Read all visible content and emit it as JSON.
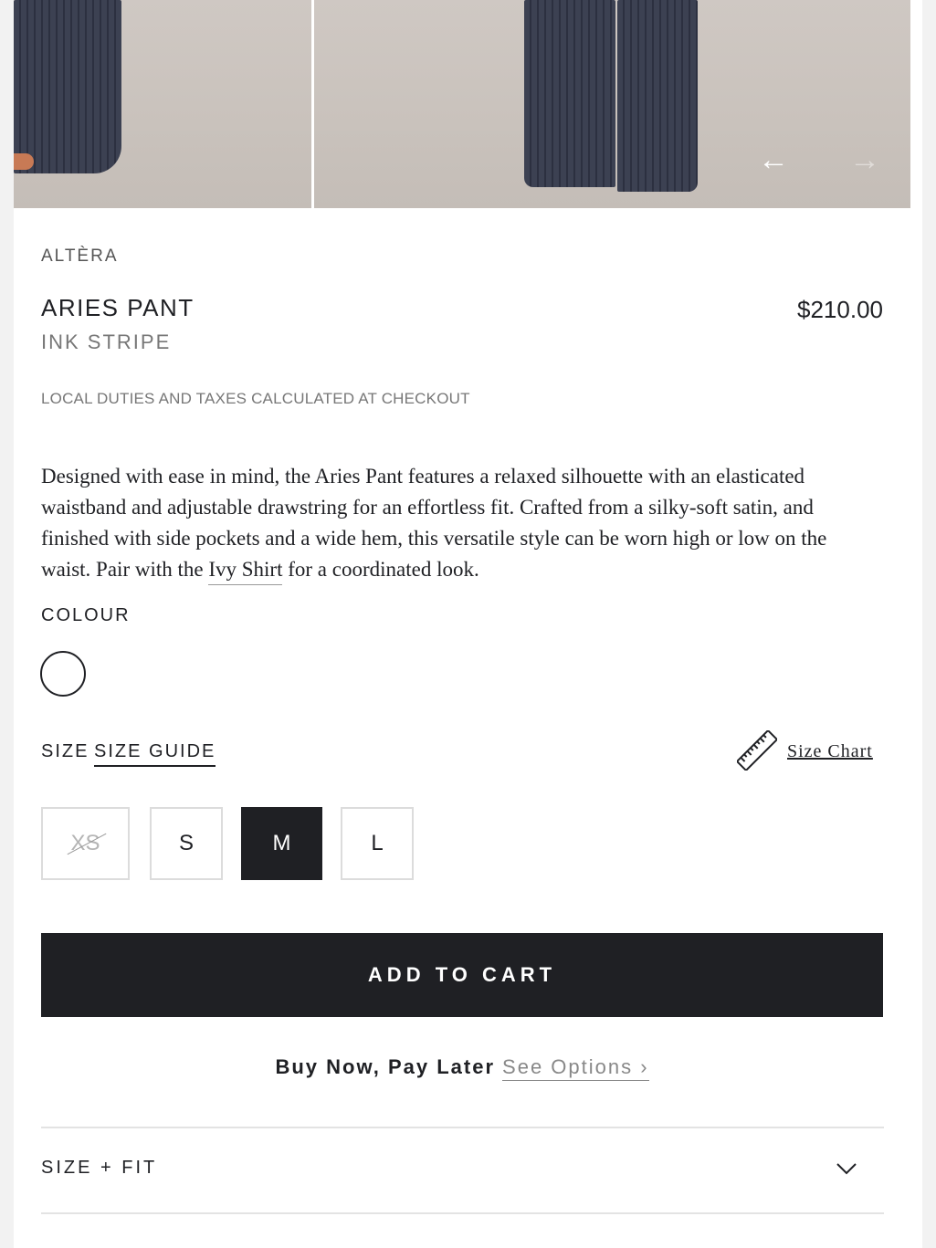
{
  "gallery": {
    "prev_arrow": "←",
    "next_arrow": "→"
  },
  "product": {
    "brand": "ALTÈRA",
    "title": "ARIES PANT",
    "price": "$210.00",
    "variant": "INK STRIPE",
    "duties_note": "LOCAL DUTIES AND TAXES CALCULATED AT CHECKOUT",
    "description_before": "Designed with ease in mind, the Aries Pant features a relaxed silhouette with an elasticated waistband and adjustable drawstring for an effortless fit. Crafted from a silky-soft satin, and finished with side pockets and a wide hem,  this versatile style can be worn high or low on the waist. Pair with the ",
    "description_link": "Ivy Shirt",
    "description_after": " for a coordinated look."
  },
  "colour": {
    "label": "COLOUR"
  },
  "size": {
    "label": "SIZE",
    "guide_label": "SIZE GUIDE",
    "chart_label": "Size Chart",
    "options": [
      {
        "label": "XS",
        "available": false
      },
      {
        "label": "S",
        "available": true
      },
      {
        "label": "M",
        "available": true,
        "selected": true
      },
      {
        "label": "L",
        "available": true
      }
    ]
  },
  "cart": {
    "button_label": "ADD TO CART"
  },
  "bnpl": {
    "text": "Buy Now, Pay Later",
    "options_link": "See Options ›"
  },
  "accordion": {
    "size_fit_label": "SIZE + FIT"
  }
}
